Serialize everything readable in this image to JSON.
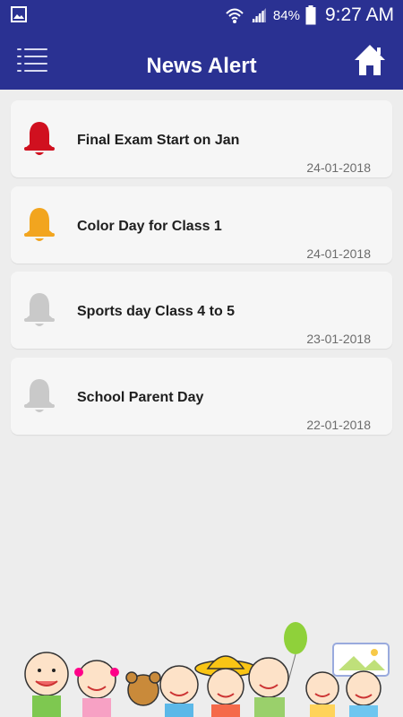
{
  "status_bar": {
    "battery_percent": "84%",
    "time": "9:27 AM"
  },
  "header": {
    "title": "News Alert",
    "menu_icon": "menu-icon",
    "home_icon": "home-icon"
  },
  "alerts": [
    {
      "title": "Final Exam Start on Jan",
      "date": "24-01-2018",
      "bell_color": "#d0101f"
    },
    {
      "title": "Color Day for Class 1",
      "date": "24-01-2018",
      "bell_color": "#f2a51f"
    },
    {
      "title": "Sports day Class 4 to 5",
      "date": "23-01-2018",
      "bell_color": "#c9c9c9"
    },
    {
      "title": "School Parent Day",
      "date": "22-01-2018",
      "bell_color": "#c9c9c9"
    }
  ],
  "colors": {
    "primary": "#2a3192",
    "background": "#ededed",
    "card": "#f6f6f6"
  }
}
